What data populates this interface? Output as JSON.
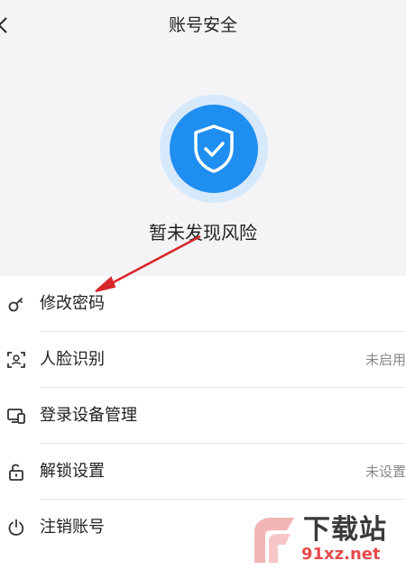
{
  "header": {
    "title": "账号安全"
  },
  "hero": {
    "status_text": "暂未发现风险"
  },
  "list": {
    "items": [
      {
        "label": "修改密码",
        "value": ""
      },
      {
        "label": "人脸识别",
        "value": "未启用"
      },
      {
        "label": "登录设备管理",
        "value": ""
      },
      {
        "label": "解锁设置",
        "value": "未设置"
      },
      {
        "label": "注销账号",
        "value": ""
      }
    ]
  },
  "watermark": {
    "brand": "下载站",
    "domain": "91xz.net",
    "logo": "9f"
  },
  "colors": {
    "accent_blue": "#1f8ef1",
    "halo_blue": "#d6e9fb",
    "hero_bg": "#f4f4f6",
    "annotation_red": "#d8262a"
  }
}
